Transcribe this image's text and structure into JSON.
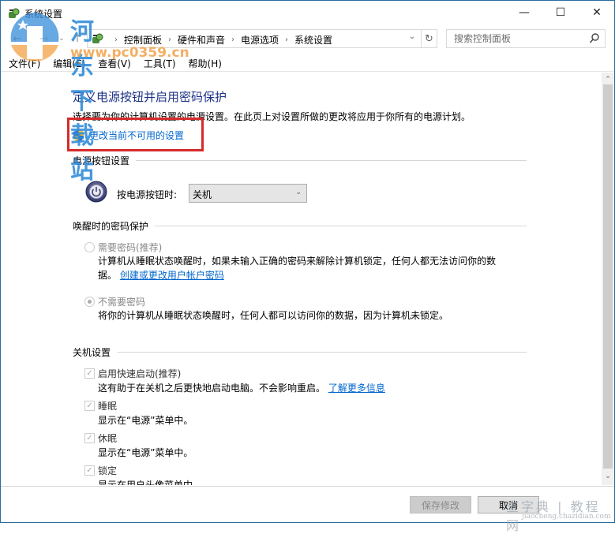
{
  "window": {
    "title": "系统设置",
    "controls": {
      "minimize": "—",
      "maximize": "☐",
      "close": "✕"
    }
  },
  "nav": {
    "back_icon": "←",
    "forward_icon": "→",
    "recent_icon": "⌄",
    "up_icon": "↑",
    "breadcrumb": [
      "控制面板",
      "硬件和声音",
      "电源选项",
      "系统设置"
    ],
    "separator": "›",
    "dropdown_icon": "⌄",
    "refresh_icon": "↻",
    "search_placeholder": "搜索控制面板"
  },
  "menu": [
    "文件(F)",
    "编辑(E)",
    "查看(V)",
    "工具(T)",
    "帮助(H)"
  ],
  "watermark": {
    "title": "河东下载站",
    "url": "www.pc0359.cn",
    "footer_text": "查字典 | 教程网",
    "footer_url": "jiaocheng.chazidian.com"
  },
  "main": {
    "title": "定义电源按钮并启用密码保护",
    "description": "选择要为你的计算机设置的电源设置。在此页上对设置所做的更改将应用于你所有的电源计划。",
    "admin_link": "更改当前不可用的设置",
    "power_button_section": {
      "heading": "电源按钮设置",
      "label": "按电源按钮时:",
      "selected": "关机",
      "arrow": "⌄"
    },
    "password_section": {
      "heading": "唤醒时的密码保护",
      "options": [
        {
          "label": "需要密码(推荐)",
          "selected": false,
          "desc_line1": "计算机从睡眠状态唤醒时，如果未输入正确的密码来解除计算机锁定，任何人都无法访问你的数",
          "desc_line2_prefix": "据。",
          "desc_link": "创建或更改用户帐户密码"
        },
        {
          "label": "不需要密码",
          "selected": true,
          "desc_line1": "将你的计算机从睡眠状态唤醒时，任何人都可以访问你的数据，因为计算机未锁定。"
        }
      ]
    },
    "shutdown_section": {
      "heading": "关机设置",
      "options": [
        {
          "label": "启用快速启动(推荐)",
          "checked": true,
          "desc": "这有助于在关机之后更快地启动电脑。不会影响重启。",
          "link": "了解更多信息"
        },
        {
          "label": "睡眠",
          "checked": true,
          "desc": "显示在“电源”菜单中。"
        },
        {
          "label": "休眠",
          "checked": true,
          "desc": "显示在“电源”菜单中。"
        },
        {
          "label": "锁定",
          "checked": true,
          "desc": "显示在用户头像菜单中。"
        }
      ]
    }
  },
  "scrollbar": {
    "up": "⌃",
    "down": "⌄"
  },
  "footer": {
    "save": "保存修改",
    "cancel": "取消"
  },
  "colors": {
    "title_blue": "#1e3287",
    "link_blue": "#0066cc",
    "highlight_red": "#d72a2a",
    "window_border": "#2b6c9c"
  }
}
